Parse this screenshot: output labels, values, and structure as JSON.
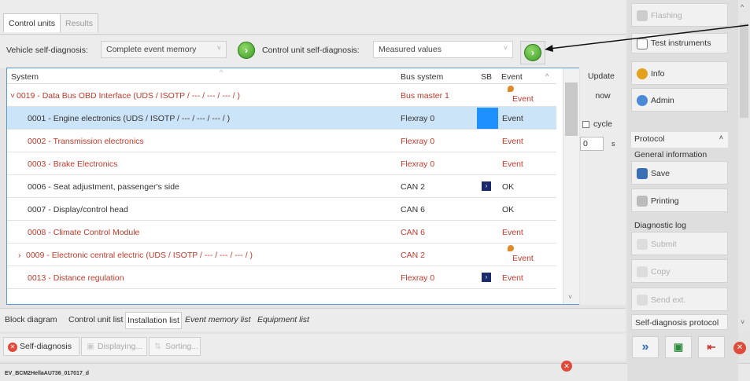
{
  "tabs": [
    {
      "label": "Control units"
    },
    {
      "label": "Results"
    }
  ],
  "diag": {
    "vehicle_label": "Vehicle self-diagnosis:",
    "vehicle_value": "Complete event memory",
    "cu_label": "Control unit self-diagnosis:",
    "cu_value": "Measured values"
  },
  "table": {
    "headers": {
      "system": "System",
      "bus": "Bus system",
      "sb": "SB",
      "event": "Event"
    },
    "rows": [
      {
        "system": "0019 - Data Bus OBD Interface  (UDS / ISOTP / --- / --- / --- / )",
        "prefix": "˅",
        "bus": "Bus master 1",
        "event": "Event",
        "sb": "",
        "bell": true
      },
      {
        "system": "0001 - Engine electronics  (UDS / ISOTP / --- / --- / --- / )",
        "prefix": "",
        "bus": "Flexray 0",
        "event": "Event",
        "sb": "selected",
        "bell": false
      },
      {
        "system": "0002 - Transmission electronics",
        "prefix": "",
        "bus": "Flexray 0",
        "event": "Event",
        "sb": "",
        "bell": false
      },
      {
        "system": "0003 - Brake Electronics",
        "prefix": "",
        "bus": "Flexray 0",
        "event": "Event",
        "sb": "",
        "bell": false
      },
      {
        "system": "0006 - Seat adjustment, passenger's side",
        "prefix": "",
        "bus": "CAN 2",
        "event": "OK",
        "sb": "icon",
        "bell": false
      },
      {
        "system": "0007 - Display/control head",
        "prefix": "",
        "bus": "CAN 6",
        "event": "OK",
        "sb": "",
        "bell": false
      },
      {
        "system": "0008 - Climate Control Module",
        "prefix": "",
        "bus": "CAN 6",
        "event": "Event",
        "sb": "",
        "bell": false
      },
      {
        "system": "0009 - Electronic central electric  (UDS / ISOTP / --- / --- / --- / )",
        "prefix": "›",
        "bus": "CAN 2",
        "event": "Event",
        "sb": "",
        "bell": true
      },
      {
        "system": "0013 - Distance regulation",
        "prefix": "",
        "bus": "Flexray 0",
        "event": "Event",
        "sb": "icon",
        "bell": false
      }
    ]
  },
  "update": {
    "title": "Update",
    "now": "now",
    "cycle": "cycle",
    "seconds_value": "0",
    "seconds_unit": "s"
  },
  "bottom_tabs": [
    "Block diagram",
    "Control unit list",
    "Installation list",
    "Event memory list",
    "Equipment list"
  ],
  "bottom_buttons": {
    "self_diag": "Self-diagnosis",
    "displaying": "Displaying...",
    "sorting": "Sorting..."
  },
  "status": {
    "text": "EV_BCM2HellaAU736_017017_d"
  },
  "right": {
    "flashing": "Flashing",
    "test_instruments": "Test instruments",
    "info": "Info",
    "admin": "Admin",
    "protocol": "Protocol",
    "general_info": "General information",
    "save": "Save",
    "printing": "Printing",
    "diag_log": "Diagnostic log",
    "submit": "Submit",
    "copy": "Copy",
    "send_ext": "Send ext.",
    "self_diag_protocol": "Self-diagnosis protocol"
  },
  "colors": {
    "red_text": "#c0392b",
    "selection": "#cce4f7",
    "accent_blue": "#1e90ff"
  }
}
